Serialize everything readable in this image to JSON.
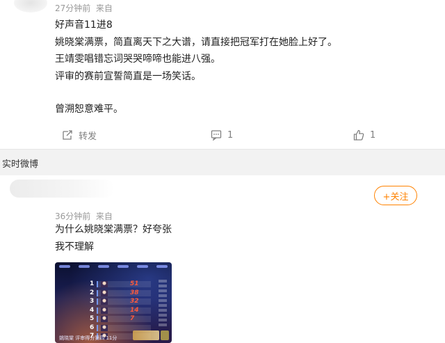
{
  "post1": {
    "time": "27分钟前",
    "source": "来自",
    "lines": [
      "好声音11进8",
      "姚晓棠满票，简直离天下之大谱，请直接把冠军打在她脸上好了。",
      "王靖雯唱错忘词哭哭啼啼也能进八强。",
      "评审的赛前宣誓简直是一场笑话。",
      "曾溯恕意难平。"
    ],
    "actions": {
      "repost_label": "转发",
      "comment_count": "1",
      "like_count": "1"
    }
  },
  "section": {
    "title": "实时微博"
  },
  "post2": {
    "follow_label": "+关注",
    "time": "36分钟前",
    "source": "来自",
    "lines": [
      "为什么姚晓棠满票？好夸张",
      "我不理解"
    ],
    "thumbnail": {
      "ranks": [
        "1",
        "2",
        "3",
        "4",
        "5",
        "6",
        "7"
      ],
      "scores": [
        "51",
        "38",
        "32",
        "14",
        "7",
        "",
        ""
      ],
      "caption": "姚晓棠 评审得分第四 11分"
    }
  },
  "colors": {
    "accent": "#ff8200",
    "meta_text": "#999999",
    "section_bg": "#f2f2f2"
  },
  "icons": [
    "repost-icon",
    "comment-icon",
    "like-icon"
  ]
}
